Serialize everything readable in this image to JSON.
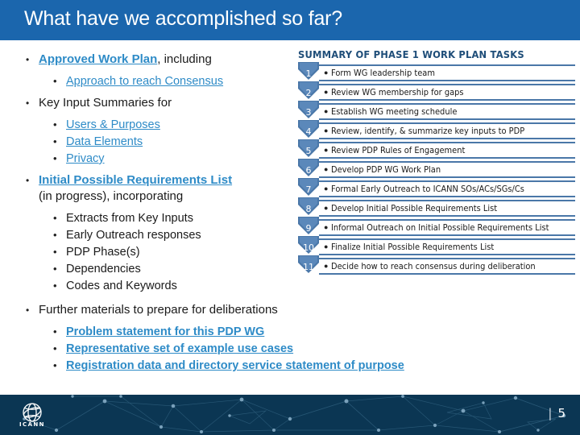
{
  "slide": {
    "title": "What have we accomplished so far?",
    "title_bar_color": "#1b66ad",
    "link_color": "#2e8bc7",
    "heading_color": "#1f4e79",
    "footer_color": "#0b3653"
  },
  "bullets": {
    "b1_link": "Approved Work Plan",
    "b1_tail": ", including",
    "b1_sub1": "Approach to reach Consensus",
    "b2": "Key Input Summaries for",
    "b2_sub1": "Users & Purposes",
    "b2_sub2": "Data Elements",
    "b2_sub3": "Privacy",
    "b3_link": "Initial Possible Requirements List",
    "b3_tail": "(in progress), incorporating",
    "b3_sub1": "Extracts from Key Inputs",
    "b3_sub2": "Early Outreach responses",
    "b3_sub3": "PDP Phase(s)",
    "b3_sub4": "Dependencies",
    "b3_sub5": "Codes and Keywords",
    "b4": "Further materials to prepare for deliberations",
    "b4_sub1": "Problem statement for this PDP WG",
    "b4_sub2": "Representative set of example use cases",
    "b4_sub3": "Registration data and directory service statement of purpose"
  },
  "tasks": {
    "heading": "SUMMARY OF PHASE 1 WORK PLAN TASKS",
    "rows": [
      {
        "num": "1",
        "label": "Form WG leadership team"
      },
      {
        "num": "2",
        "label": "Review WG membership for gaps"
      },
      {
        "num": "3",
        "label": "Establish WG meeting schedule"
      },
      {
        "num": "4",
        "label": "Review, identify, & summarize key inputs to PDP"
      },
      {
        "num": "5",
        "label": "Review PDP Rules of Engagement"
      },
      {
        "num": "6",
        "label": "Develop PDP WG Work Plan"
      },
      {
        "num": "7",
        "label": "Formal Early Outreach to ICANN SOs/ACs/SGs/Cs"
      },
      {
        "num": "8",
        "label": "Develop Initial Possible Requirements List"
      },
      {
        "num": "9",
        "label": "Informal Outreach on Initial Possible Requirements List"
      },
      {
        "num": "10",
        "label": "Finalize Initial Possible Requirements List"
      },
      {
        "num": "11",
        "label": "Decide how to reach consensus during deliberation"
      }
    ]
  },
  "footer": {
    "logo_text": "ICANN",
    "page_separator": "|",
    "page_number": "5"
  }
}
